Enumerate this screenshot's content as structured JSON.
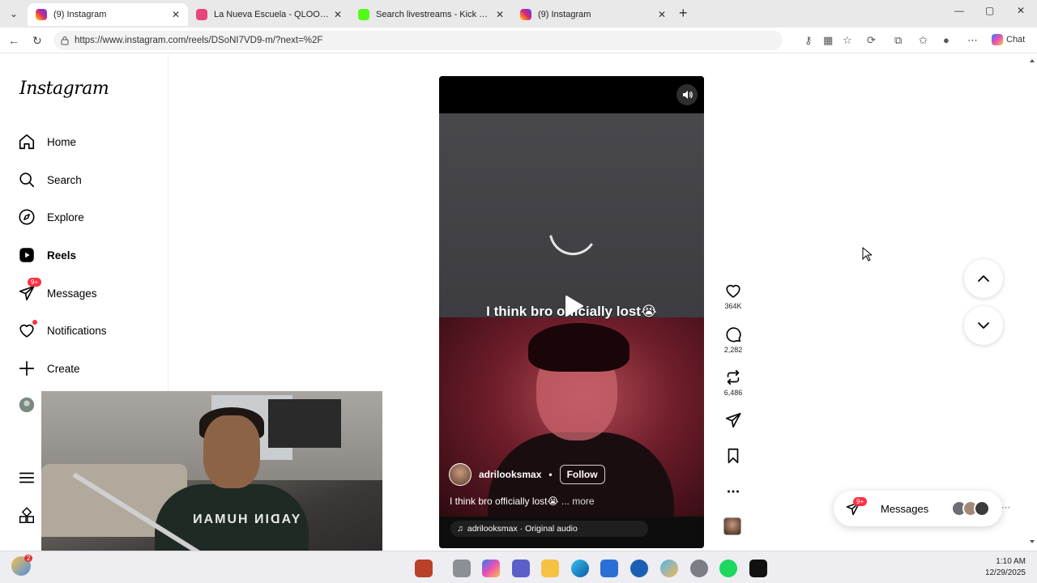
{
  "browser": {
    "tabs": [
      {
        "title": "(9) Instagram",
        "active": true
      },
      {
        "title": "La Nueva Escuela - QLOO* (Video",
        "active": false
      },
      {
        "title": "Search livestreams - Kick Streaming",
        "active": false
      },
      {
        "title": "(9) Instagram",
        "active": false
      }
    ],
    "url": "https://www.instagram.com/reels/DSoNI7VD9-m/?next=%2F",
    "chat_label": "Chat"
  },
  "sidebar": {
    "logo": "Instagram",
    "items": [
      {
        "label": "Home",
        "icon": "home-icon"
      },
      {
        "label": "Search",
        "icon": "search-icon"
      },
      {
        "label": "Explore",
        "icon": "explore-icon"
      },
      {
        "label": "Reels",
        "icon": "reels-icon",
        "active": true
      },
      {
        "label": "Messages",
        "icon": "messages-icon",
        "badge": "9+"
      },
      {
        "label": "Notifications",
        "icon": "heart-icon",
        "dot": true
      },
      {
        "label": "Create",
        "icon": "plus-icon"
      }
    ]
  },
  "webcam": {
    "sweater_text": "YADIN HUMAN"
  },
  "reel": {
    "overlay_caption": "I think bro officially lost😭",
    "author": "adrilooksmax",
    "separator": "•",
    "follow_label": "Follow",
    "caption": "I think bro officially lost😭",
    "more_label": "... more",
    "audio": "adrilooksmax · Original audio"
  },
  "actions": {
    "likes": "364K",
    "comments": "2,282",
    "reposts": "6,486"
  },
  "messages_pill": {
    "label": "Messages",
    "badge": "9+"
  },
  "taskbar": {
    "time": "1:10 AM",
    "date": "12/29/2025",
    "weather_badge": "2"
  },
  "colors": {
    "accent_red": "#ff3040",
    "reel_red": "#6e1d2a",
    "reel_grey": "#45444a"
  }
}
